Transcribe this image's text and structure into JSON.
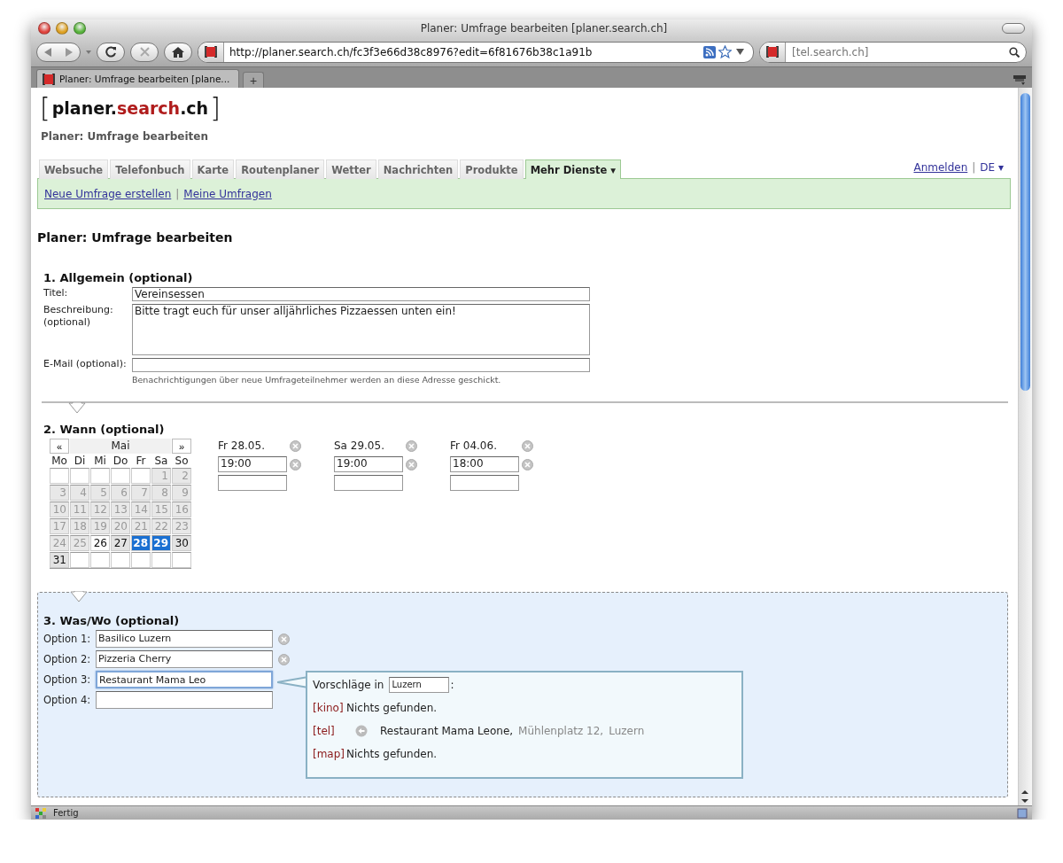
{
  "window": {
    "title": "Planer: Umfrage bearbeiten [planer.search.ch]"
  },
  "toolbar": {
    "url": "http://planer.search.ch/fc3f3e66d38c8976?edit=6f81676b38c1a91b",
    "search_placeholder": "[tel.search.ch]"
  },
  "browser_tabs": [
    {
      "label": "Planer: Umfrage bearbeiten [plane...",
      "selected": true
    }
  ],
  "new_tab": "+",
  "logo": {
    "open": "[",
    "name": "planer.",
    "brand": "search",
    "tld": ".ch",
    "close": "]"
  },
  "site_subtitle": "Planer: Umfrage bearbeiten",
  "nav_tabs": [
    {
      "label": "Websuche",
      "selected": false
    },
    {
      "label": "Telefonbuch",
      "selected": false
    },
    {
      "label": "Karte",
      "selected": false
    },
    {
      "label": "Routenplaner",
      "selected": false
    },
    {
      "label": "Wetter",
      "selected": false
    },
    {
      "label": "Nachrichten",
      "selected": false
    },
    {
      "label": "Produkte",
      "selected": false
    },
    {
      "label": "Mehr Dienste ▾",
      "selected": true
    }
  ],
  "account": {
    "login": "Anmelden",
    "separator": "|",
    "language": "DE ▾"
  },
  "subnav": {
    "links": [
      "Neue Umfrage erstellen",
      "Meine Umfragen"
    ],
    "separator": "|"
  },
  "heading": "Planer: Umfrage bearbeiten",
  "general": {
    "title": "1. Allgemein (optional)",
    "fields": [
      {
        "kind": "input",
        "label": "Titel:",
        "value": "Vereinsessen"
      },
      {
        "kind": "textarea",
        "label": "Beschreibung:\n(optional)",
        "value": "Bitte tragt euch für unser alljährliches Pizzaessen unten ein!"
      },
      {
        "kind": "input",
        "label": "E-Mail (optional):",
        "hint": "Benachrichtigungen über neue Umfrageteilnehmer werden an diese Adresse geschickt."
      }
    ]
  },
  "when": {
    "title": "2. Wann (optional)",
    "calendar": {
      "prev": "«",
      "month": "Mai",
      "next": "»",
      "weekdays": [
        "Mo",
        "Di",
        "Mi",
        "Do",
        "Fr",
        "Sa",
        "So"
      ],
      "weeks": [
        [
          {
            "kind": "empty"
          },
          {
            "kind": "empty"
          },
          {
            "kind": "empty"
          },
          {
            "kind": "empty"
          },
          {
            "kind": "empty"
          },
          {
            "kind": "past",
            "day": "1",
            "selected": false
          },
          {
            "kind": "past",
            "day": "2",
            "selected": false
          }
        ],
        [
          {
            "kind": "past",
            "day": "3",
            "selected": false
          },
          {
            "kind": "past",
            "day": "4",
            "selected": false
          },
          {
            "kind": "past",
            "day": "5",
            "selected": false
          },
          {
            "kind": "past",
            "day": "6",
            "selected": false
          },
          {
            "kind": "past",
            "day": "7",
            "selected": false
          },
          {
            "kind": "past",
            "day": "8",
            "selected": false
          },
          {
            "kind": "past",
            "day": "9",
            "selected": false
          }
        ],
        [
          {
            "kind": "past",
            "day": "10",
            "selected": false
          },
          {
            "kind": "past",
            "day": "11",
            "selected": false
          },
          {
            "kind": "past",
            "day": "12",
            "selected": false
          },
          {
            "kind": "past",
            "day": "13",
            "selected": false
          },
          {
            "kind": "past",
            "day": "14",
            "selected": false
          },
          {
            "kind": "past",
            "day": "15",
            "selected": false
          },
          {
            "kind": "past",
            "day": "16",
            "selected": false
          }
        ],
        [
          {
            "kind": "past",
            "day": "17",
            "selected": false
          },
          {
            "kind": "past",
            "day": "18",
            "selected": false
          },
          {
            "kind": "past",
            "day": "19",
            "selected": false
          },
          {
            "kind": "past",
            "day": "20",
            "selected": false
          },
          {
            "kind": "past",
            "day": "21",
            "selected": false
          },
          {
            "kind": "past",
            "day": "22",
            "selected": false
          },
          {
            "kind": "past",
            "day": "23",
            "selected": false
          }
        ],
        [
          {
            "kind": "past",
            "day": "24",
            "selected": false
          },
          {
            "kind": "past",
            "day": "25",
            "selected": false
          },
          {
            "kind": "open",
            "day": "26",
            "selected": false
          },
          {
            "kind": "marked",
            "day": "27",
            "selected": false
          },
          {
            "kind": "marked",
            "day": "28",
            "selected": true
          },
          {
            "kind": "marked",
            "day": "29",
            "selected": true
          },
          {
            "kind": "marked",
            "day": "30",
            "selected": false
          }
        ],
        [
          {
            "kind": "marked",
            "day": "31",
            "selected": false
          },
          {
            "kind": "empty"
          },
          {
            "kind": "empty"
          },
          {
            "kind": "empty"
          },
          {
            "kind": "empty"
          },
          {
            "kind": "empty"
          },
          {
            "kind": "empty"
          }
        ]
      ]
    },
    "dates": [
      {
        "label": "Fr 28.05.",
        "times": [
          "19:00"
        ]
      },
      {
        "label": "Sa 29.05.",
        "times": [
          "19:00"
        ]
      },
      {
        "label": "Fr 04.06.",
        "times": [
          "18:00"
        ]
      }
    ]
  },
  "what": {
    "title": "3. Was/Wo (optional)",
    "options": [
      {
        "label": "Option 1:",
        "value": "Basilico Luzern",
        "removable": true,
        "focused": false
      },
      {
        "label": "Option 2:",
        "value": "Pizzeria Cherry",
        "removable": true,
        "focused": false
      },
      {
        "label": "Option 3:",
        "value": "Restaurant Mama Leo",
        "removable": false,
        "focused": true
      },
      {
        "label": "Option 4:",
        "removable": false,
        "focused": false
      }
    ],
    "suggestions": {
      "intro": "Vorschläge in",
      "location": "Luzern",
      "colon": ":",
      "rows": [
        {
          "kind": "none",
          "source": "[kino]",
          "text": "Nichts gefunden."
        },
        {
          "kind": "result",
          "source": "[tel]",
          "name": "Restaurant Mama Leone,",
          "street": "Mühlenplatz 12,",
          "city": "Luzern"
        },
        {
          "kind": "none",
          "source": "[map]",
          "text": "Nichts gefunden."
        }
      ]
    }
  },
  "status_bar": {
    "text": "Fertig"
  }
}
